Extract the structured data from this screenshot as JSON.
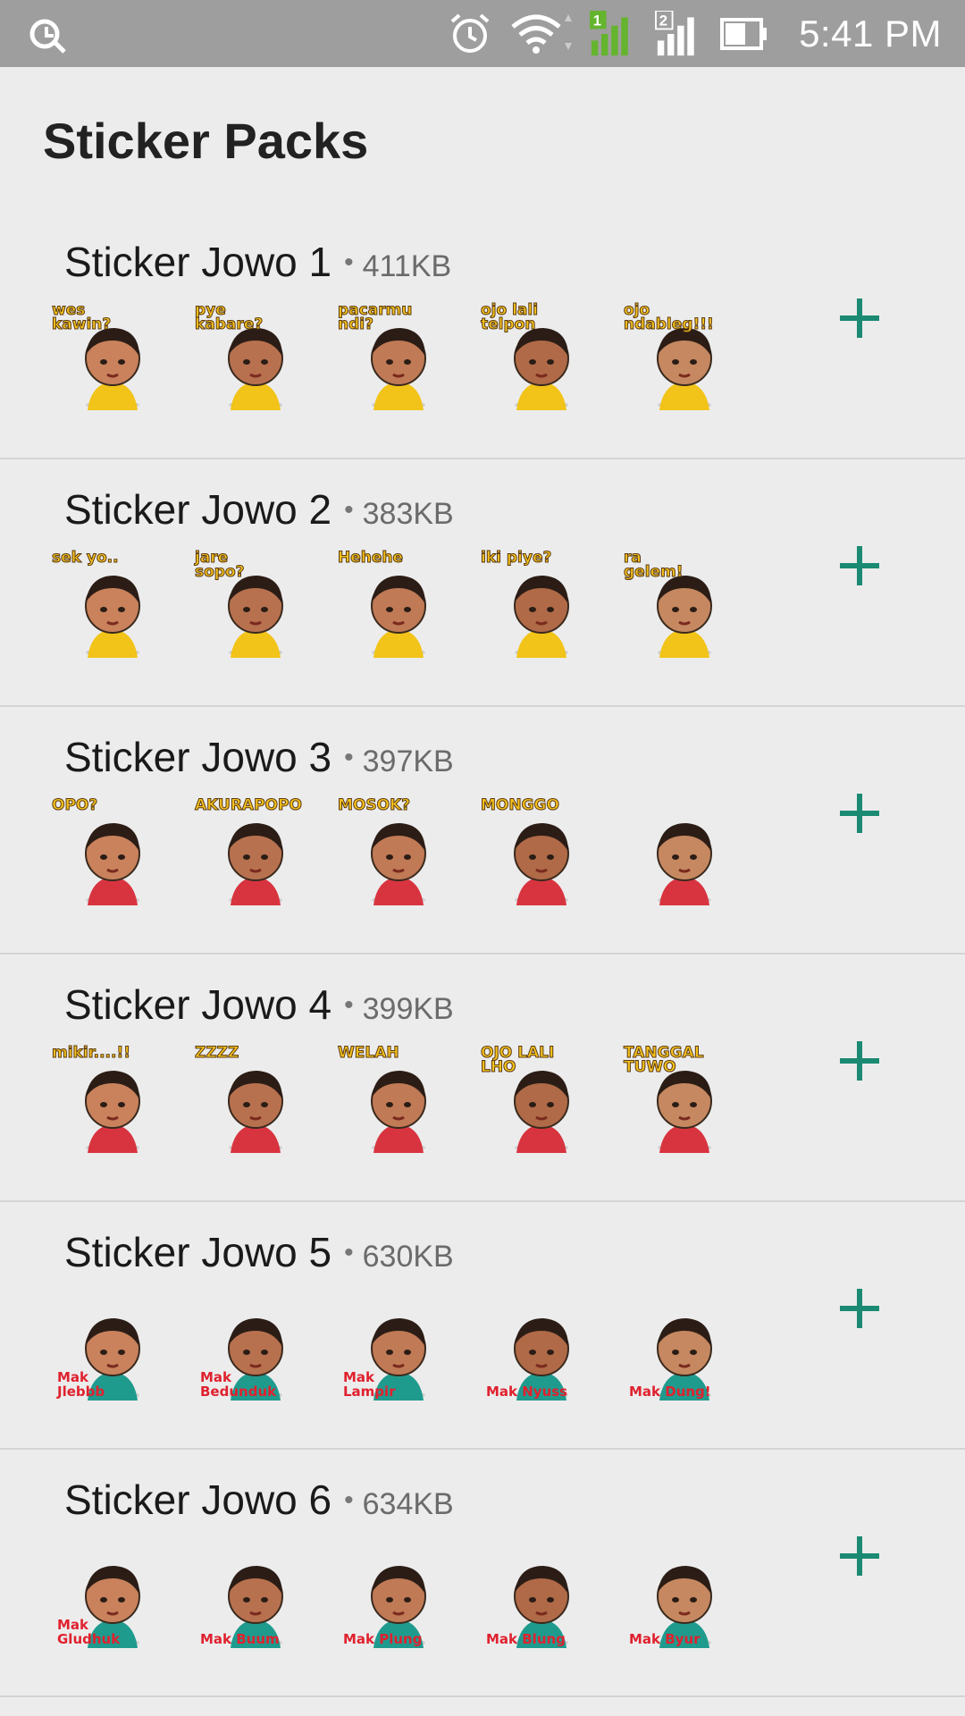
{
  "status_bar": {
    "time": "5:41 PM",
    "icons": [
      "app-sync-icon",
      "alarm-icon",
      "wifi-icon",
      "signal-sim1-icon",
      "signal-sim2-icon",
      "battery-icon"
    ],
    "sim1_label": "1",
    "sim2_label": "2"
  },
  "page": {
    "title": "Sticker Packs"
  },
  "colors": {
    "accent": "#1b8a72",
    "status_bar": "#9e9e9e",
    "background": "#ececec",
    "sim1": "#64b42d"
  },
  "packs": [
    {
      "name": "Sticker Jowo 1",
      "size": "411KB",
      "stickers": [
        "wes kawin?",
        "pye kabare?",
        "pacarmu ndi?",
        "ojo lali telpon",
        "ojo ndableg!!!"
      ]
    },
    {
      "name": "Sticker Jowo 2",
      "size": "383KB",
      "stickers": [
        "sek yo..",
        "jare sopo?",
        "Hehehe",
        "iki piye?",
        "ra gelem!"
      ]
    },
    {
      "name": "Sticker Jowo 3",
      "size": "397KB",
      "stickers": [
        "OPO?",
        "AKURAPOPO",
        "MOSOK?",
        "MONGGO",
        ""
      ]
    },
    {
      "name": "Sticker Jowo 4",
      "size": "399KB",
      "stickers": [
        "mikir....!!",
        "ZZZZ",
        "WELAH",
        "OJO LALI LHO",
        "TANGGAL TUWO"
      ]
    },
    {
      "name": "Sticker Jowo 5",
      "size": "630KB",
      "stickers": [
        "Mak Jlebbb",
        "Mak Bedunduk",
        "Mak Lampir",
        "Mak Nyuss",
        "Mak Dung!"
      ]
    },
    {
      "name": "Sticker Jowo 6",
      "size": "634KB",
      "stickers": [
        "Mak Gludhuk",
        "Mak Buum",
        "Mak Plung",
        "Mak Blung",
        "Mak Byur"
      ]
    }
  ],
  "dot_separator": "•"
}
